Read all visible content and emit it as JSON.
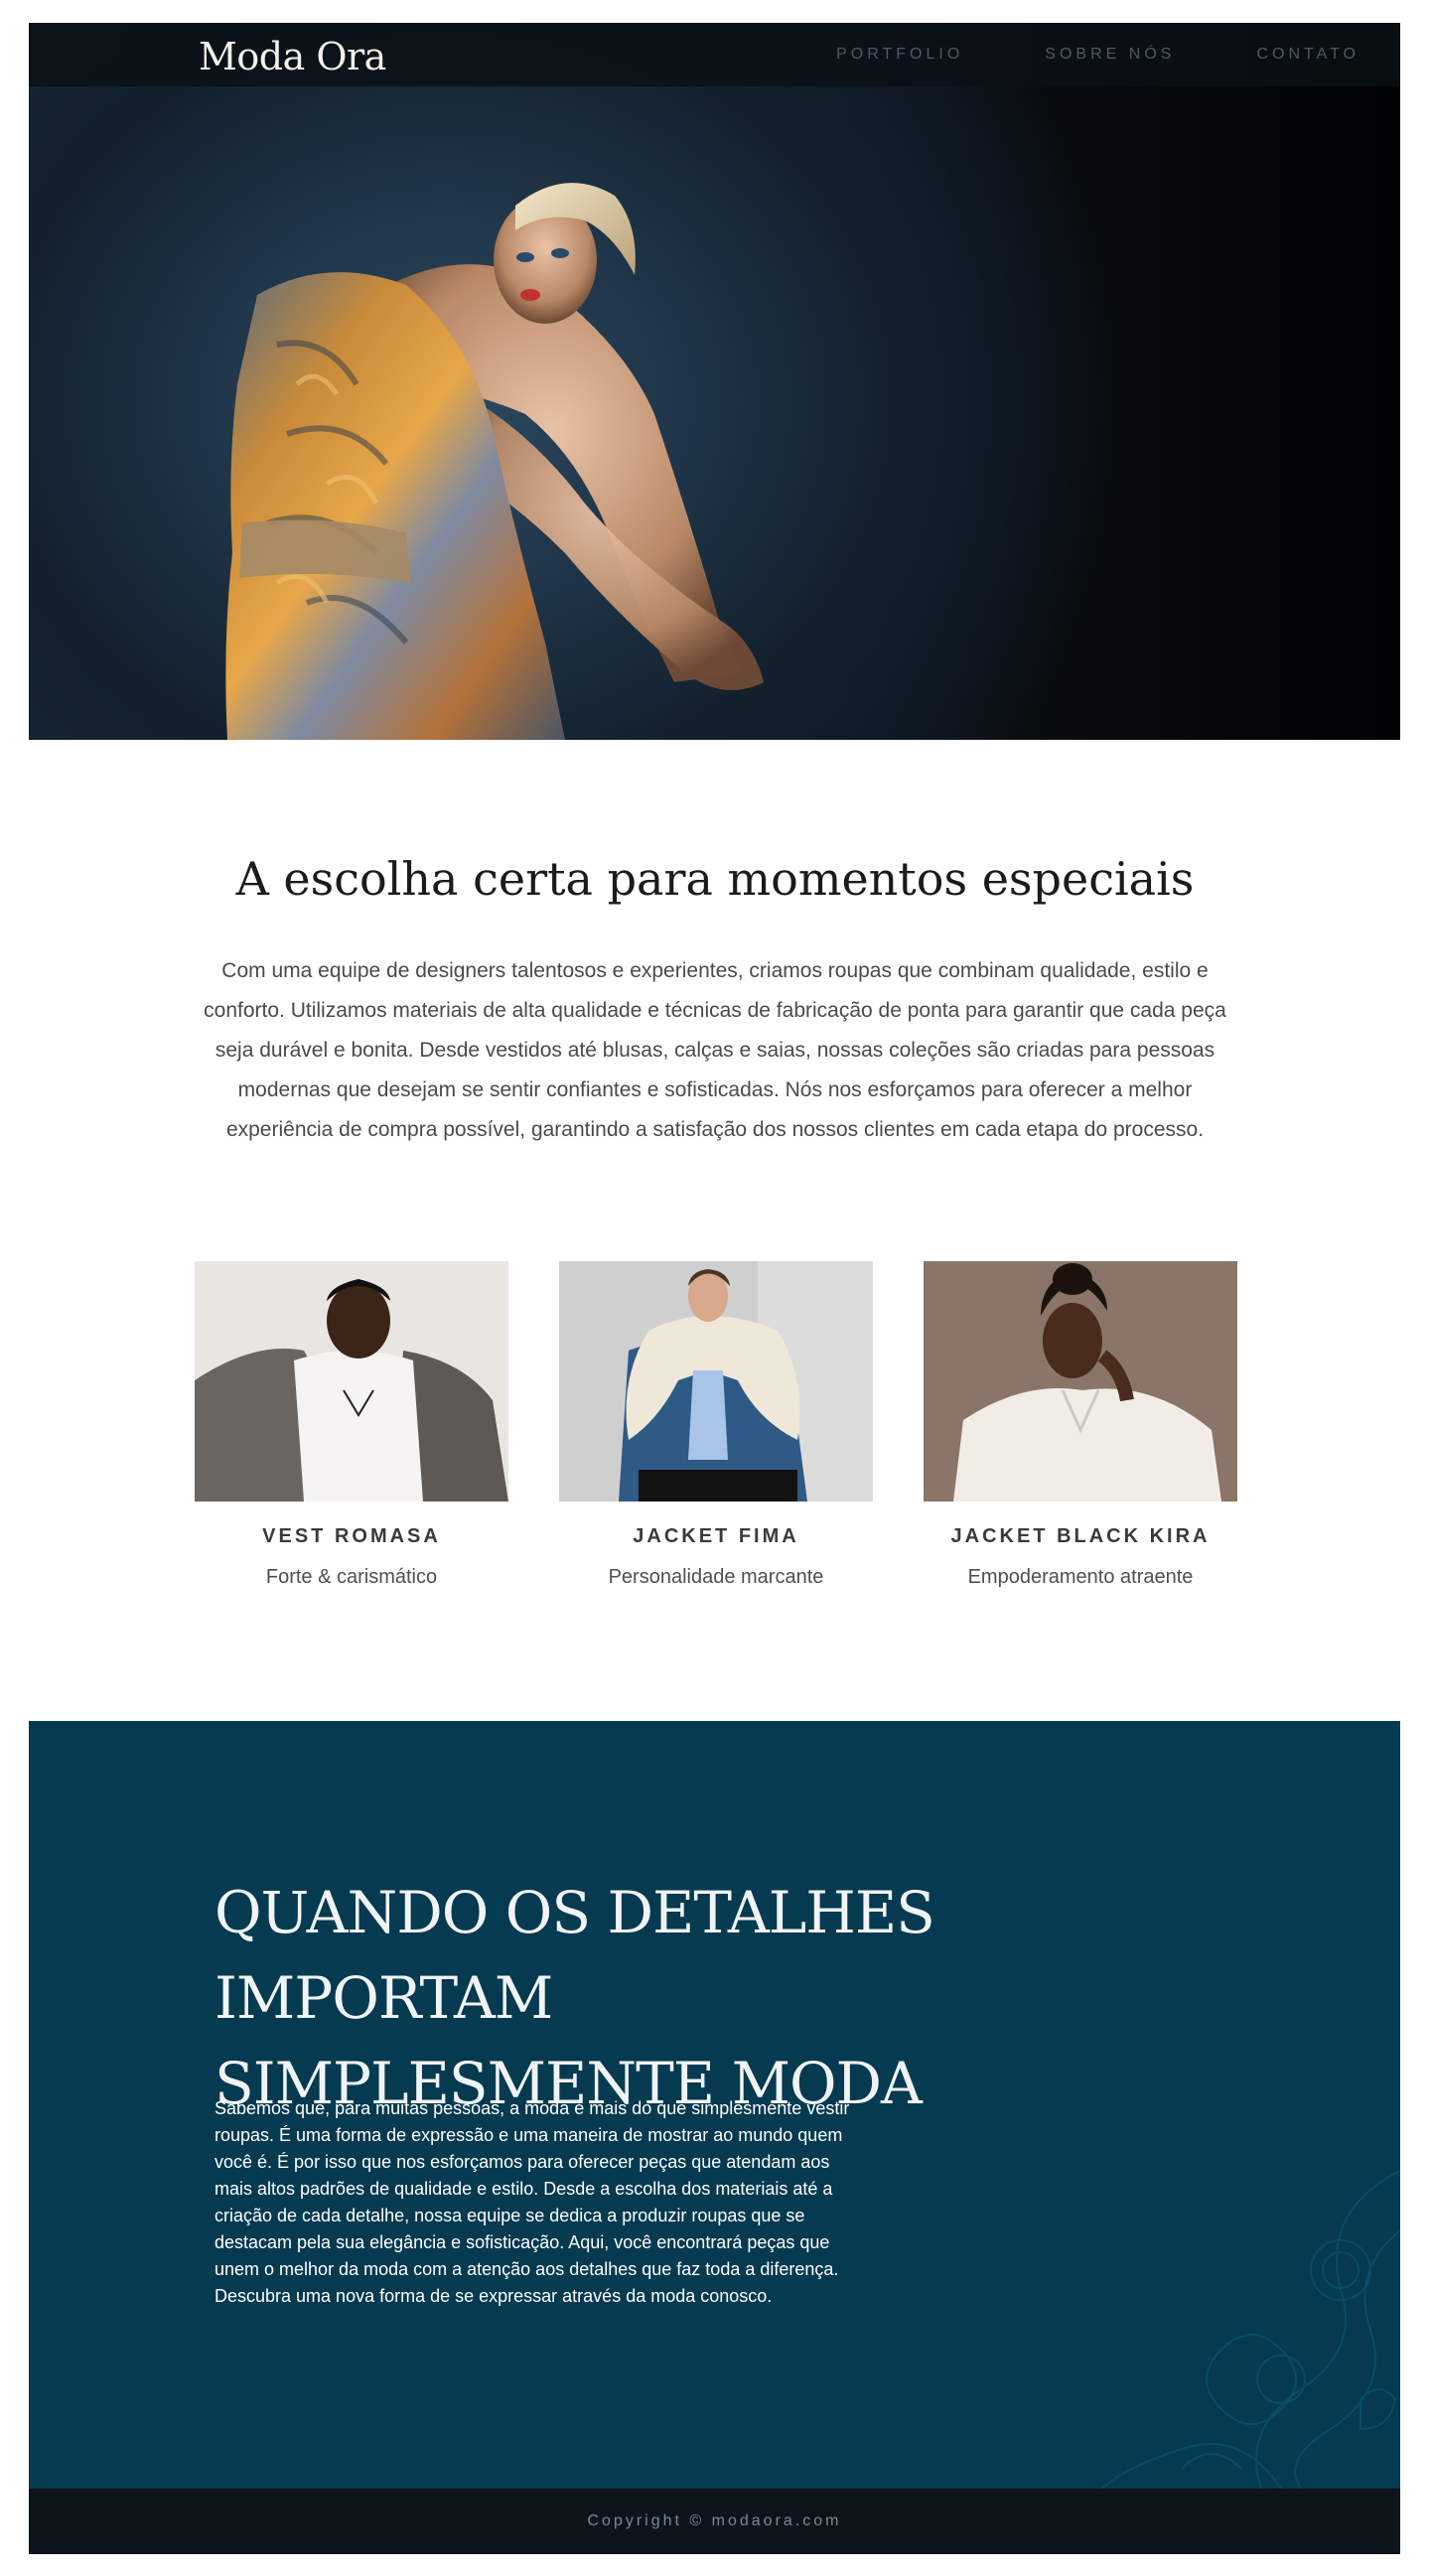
{
  "brand": {
    "logo": "Moda Ora"
  },
  "nav": {
    "items": [
      "PORTFOLIO",
      "SOBRE NÓS",
      "CONTATO"
    ]
  },
  "intro": {
    "title": "A escolha certa para momentos especiais",
    "body": "Com uma equipe de designers talentosos e experientes, criamos roupas que combinam qualidade, estilo e conforto. Utilizamos materiais de alta qualidade e técnicas de fabricação de ponta para garantir que cada peça seja durável e bonita. Desde vestidos até blusas, calças e saias, nossas coleções são criadas para pessoas modernas que desejam se sentir confiantes e sofisticadas. Nós nos esforçamos para oferecer a melhor experiência de compra possível, garantindo a satisfação dos nossos clientes em cada etapa do processo."
  },
  "products": [
    {
      "name": "VEST ROMASA",
      "tagline": "Forte & carismático"
    },
    {
      "name": "JACKET FIMA",
      "tagline": "Personalidade marcante"
    },
    {
      "name": "JACKET BLACK KIRA",
      "tagline": "Empoderamento atraente"
    }
  ],
  "feature": {
    "title_line1": "QUANDO OS DETALHES IMPORTAM",
    "title_line2": "SIMPLESMENTE MODA",
    "body": "Sabemos que, para muitas pessoas, a moda é mais do que simplesmente vestir roupas. É uma forma de expressão e uma maneira de mostrar ao mundo quem você é. É por isso que nos esforçamos para oferecer peças que atendam aos mais altos padrões de qualidade e estilo. Desde a escolha dos materiais até a criação de cada detalhe, nossa equipe se dedica a produzir roupas que se destacam pela sua elegância e sofisticação. Aqui, você encontrará peças que unem o melhor da moda com a atenção aos detalhes que faz toda a diferença. Descubra uma nova forma de se expressar através da moda conosco."
  },
  "footer": {
    "copyright": "Copyright © modaora.com"
  },
  "colors": {
    "hero_dark": "#0b141b",
    "feature_bg": "#053a50",
    "footer_bg": "#0b141b",
    "nav_text": "#4e5a64"
  }
}
